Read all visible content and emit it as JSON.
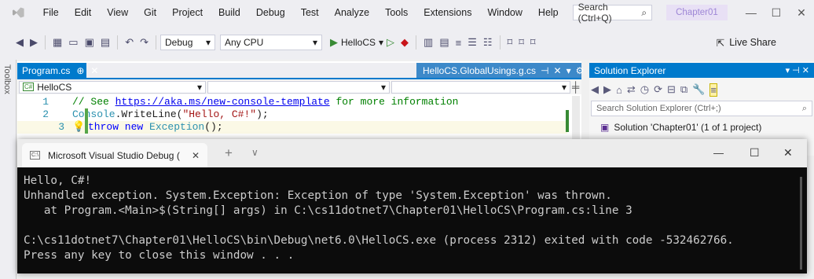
{
  "menubar": {
    "items": [
      "File",
      "Edit",
      "View",
      "Git",
      "Project",
      "Build",
      "Debug",
      "Test",
      "Analyze",
      "Tools",
      "Extensions",
      "Window",
      "Help"
    ],
    "search_placeholder": "Search (Ctrl+Q)",
    "solution_name": "Chapter01",
    "minimize": "—",
    "maximize": "☐",
    "close": "✕"
  },
  "toolbar": {
    "config": "Debug",
    "platform": "Any CPU",
    "run_target": "HelloCS",
    "live_share": "Live Share"
  },
  "toolbox": {
    "label": "Toolbox"
  },
  "editor": {
    "tabs": [
      {
        "label": "Program.cs",
        "pin": "⊕",
        "close": "✕"
      },
      {
        "label": "HelloCS.GlobalUsings.g.cs",
        "pin": "⊣",
        "close": "✕"
      }
    ],
    "nav_project": "HelloCS",
    "lines": [
      {
        "num": "1",
        "comment": "// See ",
        "link": "https://aka.ms/new-console-template",
        "rest": " for more information"
      },
      {
        "num": "2",
        "code_class": "Console",
        "code_rest": ".WriteLine(",
        "string": "\"Hello, C#!\"",
        "end": ");"
      },
      {
        "num": "3",
        "keyword": "throw new ",
        "type": "Exception",
        "end": "();"
      }
    ]
  },
  "solution_explorer": {
    "title": "Solution Explorer",
    "search_placeholder": "Search Solution Explorer (Ctrl+;)",
    "solution_item": "Solution 'Chapter01' (1 of 1 project)"
  },
  "console": {
    "tab_title": "Microsoft Visual Studio Debug (",
    "tab_close": "✕",
    "new_tab": "+",
    "dropdown": "∨",
    "minimize": "—",
    "maximize": "☐",
    "close": "✕",
    "lines": [
      "Hello, C#!",
      "Unhandled exception. System.Exception: Exception of type 'System.Exception' was thrown.",
      "   at Program.<Main>$(String[] args) in C:\\cs11dotnet7\\Chapter01\\HelloCS\\Program.cs:line 3",
      "",
      "C:\\cs11dotnet7\\Chapter01\\HelloCS\\bin\\Debug\\net6.0\\HelloCS.exe (process 2312) exited with code -532462766.",
      "Press any key to close this window . . ."
    ]
  }
}
